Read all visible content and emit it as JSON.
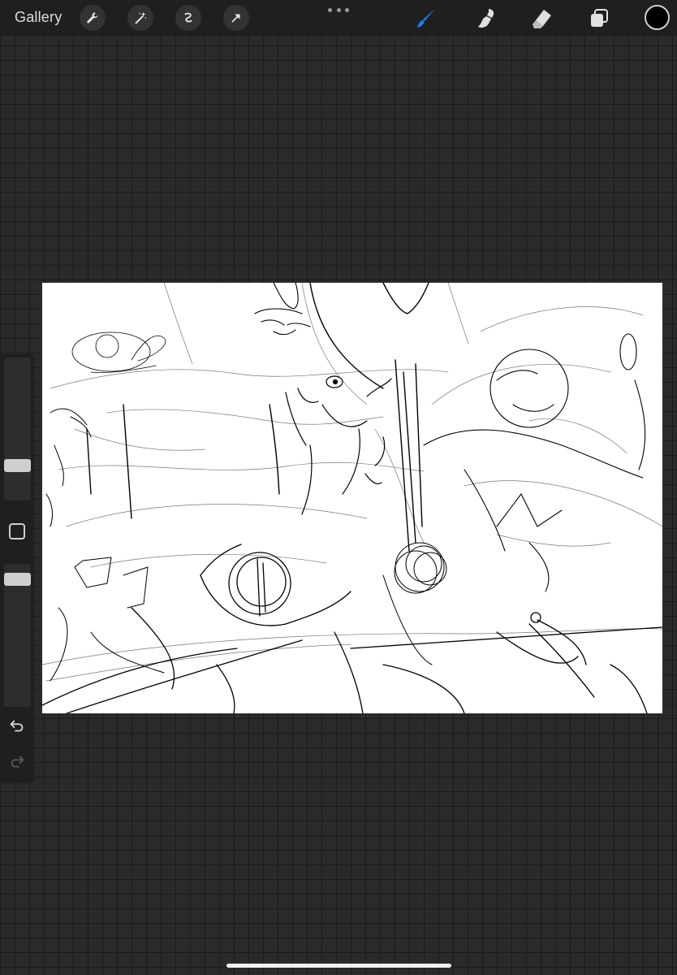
{
  "toolbar": {
    "gallery_label": "Gallery",
    "left_tools": [
      "wrench-icon",
      "magic-wand-icon",
      "selection-icon",
      "transform-arrow-icon"
    ],
    "right_tools": [
      "brush-icon",
      "smudge-icon",
      "eraser-icon",
      "layers-icon"
    ],
    "active_tool": "brush-icon",
    "active_color": "#1a7cf0",
    "current_color": "#000000"
  },
  "sidebar": {
    "brush_size_level": 0.78,
    "opacity_level": 0.07,
    "modify_button": "square-icon",
    "undo": "undo-icon",
    "redo": "redo-icon"
  }
}
